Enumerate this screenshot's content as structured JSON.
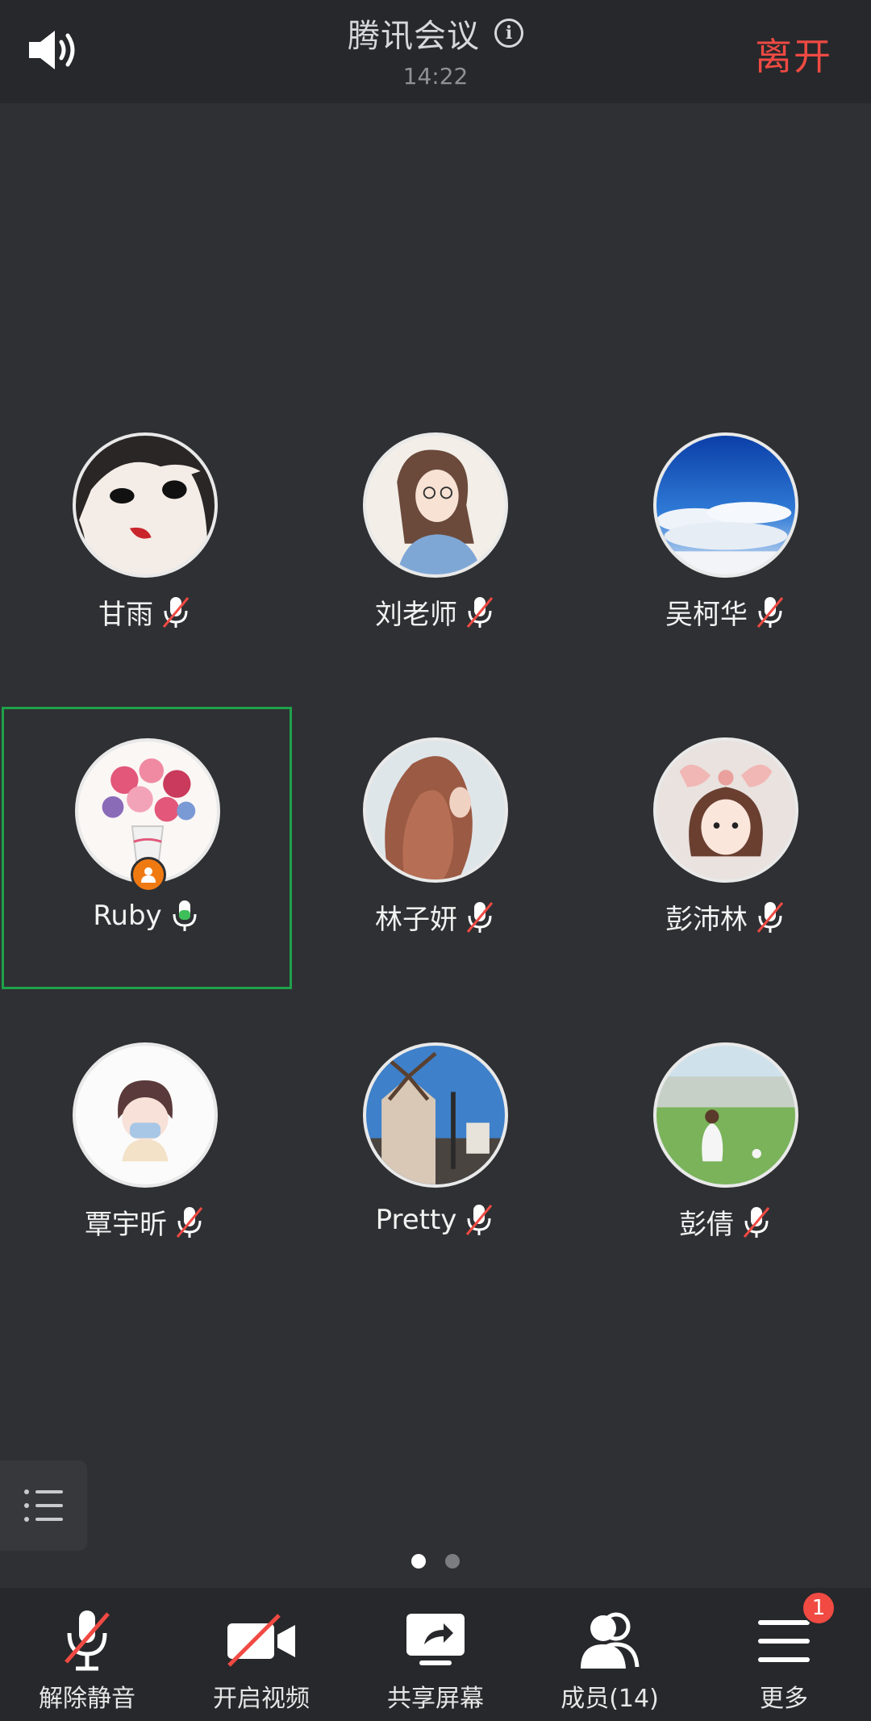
{
  "header": {
    "title": "腾讯会议",
    "time": "14:22",
    "leave_label": "离开"
  },
  "participants": [
    {
      "name": "甘雨",
      "mic": "muted",
      "avatar": "anime-girl-dark-hair"
    },
    {
      "name": "刘老师",
      "mic": "muted",
      "avatar": "girl-with-glasses"
    },
    {
      "name": "吴柯华",
      "mic": "muted",
      "avatar": "sky-clouds"
    },
    {
      "name": "Ruby",
      "mic": "on",
      "avatar": "flower-bouquet",
      "host": true,
      "active": true
    },
    {
      "name": "林子妍",
      "mic": "muted",
      "avatar": "curly-hair-girl"
    },
    {
      "name": "彭沛林",
      "mic": "muted",
      "avatar": "girl-with-bow"
    },
    {
      "name": "覃宇昕",
      "mic": "muted",
      "avatar": "girl-with-mask"
    },
    {
      "name": "Pretty",
      "mic": "muted",
      "avatar": "windmill-street"
    },
    {
      "name": "彭倩",
      "mic": "muted",
      "avatar": "girl-on-lawn"
    }
  ],
  "pagination": {
    "current": 1,
    "total": 2
  },
  "toolbar": {
    "unmute_label": "解除静音",
    "video_label": "开启视频",
    "share_label": "共享屏幕",
    "members_label": "成员(14)",
    "more_label": "更多",
    "more_badge": "1"
  },
  "colors": {
    "accent_red": "#f04a43",
    "active_border": "#1ea14a",
    "mic_on": "#3fbf5a",
    "host_badge": "#f07a12"
  }
}
